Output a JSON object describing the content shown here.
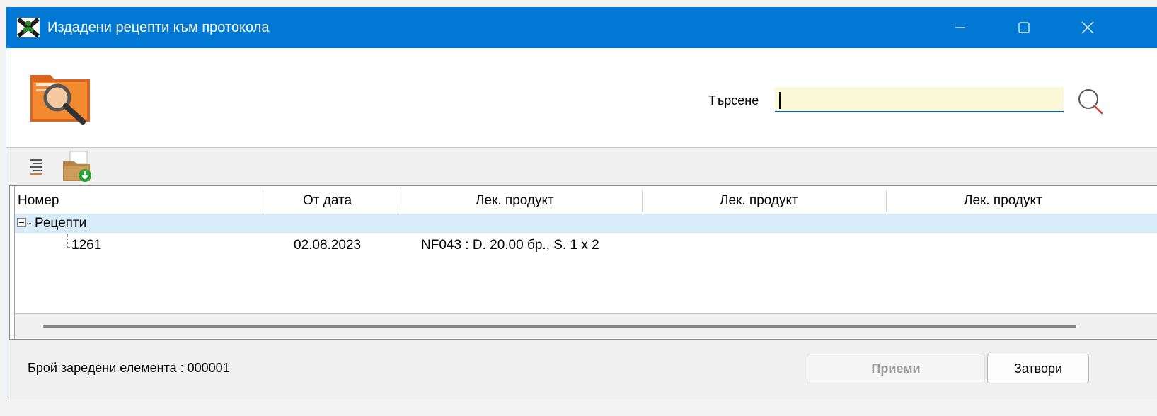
{
  "window": {
    "title": "Издадени рецепти към протокола",
    "app_icon": "app-logo-icon"
  },
  "search": {
    "label": "Търсене",
    "value": "",
    "icon": "search-icon",
    "highlight_color": "#fbf8d8"
  },
  "toolbar": {
    "items": [
      "list-indent-icon",
      "folder-download-icon"
    ]
  },
  "grid": {
    "columns": [
      "Номер",
      "От дата",
      "Лек. продукт",
      "Лек. продукт",
      "Лек. продукт"
    ],
    "group": {
      "label": "Рецепти",
      "rows": [
        {
          "number": "1261",
          "date": "02.08.2023",
          "product1": "NF043 : D. 20.00 бр., S. 1 x 2",
          "product2": "",
          "product3": ""
        }
      ]
    },
    "selected_row_color": "#d9ecfa"
  },
  "footer": {
    "count_text": "Брой заредени елемента : 000001",
    "accept_label": "Приеми",
    "close_label": "Затвори"
  },
  "colors": {
    "titlebar": "#0078d4",
    "accent": "#0a5fb4"
  }
}
